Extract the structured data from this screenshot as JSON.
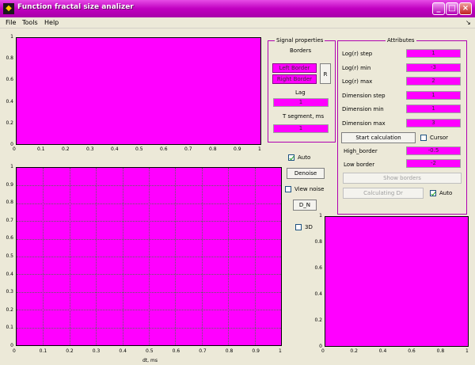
{
  "window": {
    "title": "Function fractal size analizer"
  },
  "menu": [
    "File",
    "Tools",
    "Help"
  ],
  "top_axes": {
    "xticks": [
      "0",
      "0.1",
      "0.2",
      "0.3",
      "0.4",
      "0.5",
      "0.6",
      "0.7",
      "0.8",
      "0.9",
      "1"
    ],
    "yticks": [
      "1",
      "0.8",
      "0.6",
      "0.4",
      "0.2",
      "0"
    ]
  },
  "main_axes": {
    "xticks": [
      "0",
      "0.1",
      "0.2",
      "0.3",
      "0.4",
      "0.5",
      "0.6",
      "0.7",
      "0.8",
      "0.9",
      "1"
    ],
    "yticks": [
      "1",
      "0.9",
      "0.8",
      "0.7",
      "0.6",
      "0.5",
      "0.4",
      "0.3",
      "0.2",
      "0.1",
      "0"
    ],
    "xlabel": "dt, ms"
  },
  "right_axes": {
    "xticks": [
      "0",
      "0.2",
      "0.4",
      "0.6",
      "0.8",
      "1"
    ],
    "yticks": [
      "1",
      "0.8",
      "0.6",
      "0.4",
      "0.2",
      "0"
    ]
  },
  "signal_panel": {
    "title": "Signal properties",
    "borders_label": "Borders",
    "left_border": "Left Border",
    "right_border": "Right Border",
    "r_button": "R",
    "lag_label": "Lag",
    "lag_value": "1",
    "t_label": "T segment, ms",
    "t_value": "1"
  },
  "attributes_panel": {
    "title": "Attributes",
    "rows": [
      {
        "label": "Log(r) step",
        "value": "1"
      },
      {
        "label": "Log(r) min",
        "value": "-3"
      },
      {
        "label": "Log(r) max",
        "value": "2"
      },
      {
        "label": "Dimension step",
        "value": "1"
      },
      {
        "label": "Dimension min",
        "value": "1"
      },
      {
        "label": "Dimension max",
        "value": "3"
      }
    ],
    "start_button": "Start calculation",
    "cursor_label": "Cursor",
    "high_border_label": "High_border",
    "high_border_value": "-0.5",
    "low_border_label": "Low border",
    "low_border_value": "-2",
    "show_borders_button": "Show borders",
    "calc_button": "Calculating Dr",
    "auto_label": "Auto"
  },
  "controls": {
    "auto_label": "Auto",
    "denoise_button": "Denoise",
    "view_noise_label": "View noise",
    "dn_button": "D_N",
    "threed_label": "3D"
  }
}
